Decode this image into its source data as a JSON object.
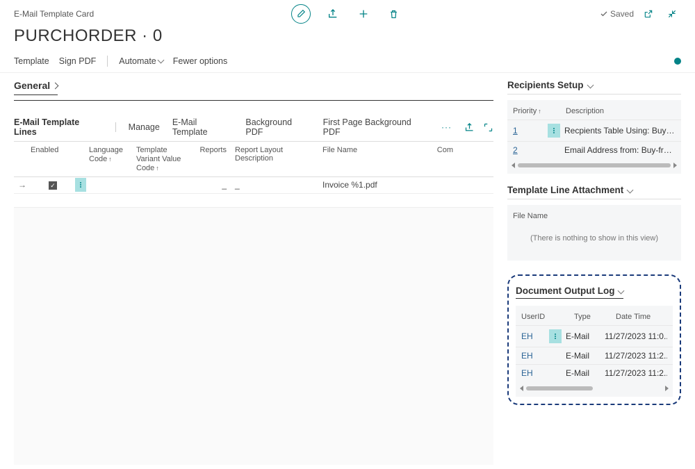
{
  "header": {
    "breadcrumb": "E-Mail Template Card",
    "saved": "Saved",
    "title": "PURCHORDER · 0"
  },
  "toolbar": {
    "template": "Template",
    "sign_pdf": "Sign PDF",
    "automate": "Automate",
    "fewer_options": "Fewer options"
  },
  "general": {
    "title": "General"
  },
  "lines": {
    "title": "E-Mail Template Lines",
    "manage": "Manage",
    "email_template": "E-Mail Template",
    "background_pdf": "Background PDF",
    "first_page_bg": "First Page Background PDF",
    "columns": {
      "enabled": "Enabled",
      "language": "Language Code",
      "variant": "Template Variant Value Code",
      "reports": "Reports",
      "layout": "Report Layout Description",
      "filename": "File Name",
      "com": "Com"
    },
    "row1": {
      "reports": "_",
      "layout": "_",
      "filename": "Invoice %1.pdf"
    }
  },
  "recipients": {
    "title": "Recipients Setup",
    "col_priority": "Priority",
    "col_description": "Description",
    "rows": [
      {
        "priority": "1",
        "desc": "Recpients Table Using: Buy-fro.."
      },
      {
        "priority": "2",
        "desc": "Email Address from: Buy-from ."
      }
    ]
  },
  "attachment": {
    "title": "Template Line Attachment",
    "col_filename": "File Name",
    "empty": "(There is nothing to show in this view)"
  },
  "log": {
    "title": "Document Output Log",
    "col_user": "UserID",
    "col_type": "Type",
    "col_datetime": "Date Time",
    "rows": [
      {
        "user": "EH",
        "type": "E-Mail",
        "dt": "11/27/2023 11:0.."
      },
      {
        "user": "EH",
        "type": "E-Mail",
        "dt": "11/27/2023 11:2.."
      },
      {
        "user": "EH",
        "type": "E-Mail",
        "dt": "11/27/2023 11:2.."
      }
    ]
  }
}
